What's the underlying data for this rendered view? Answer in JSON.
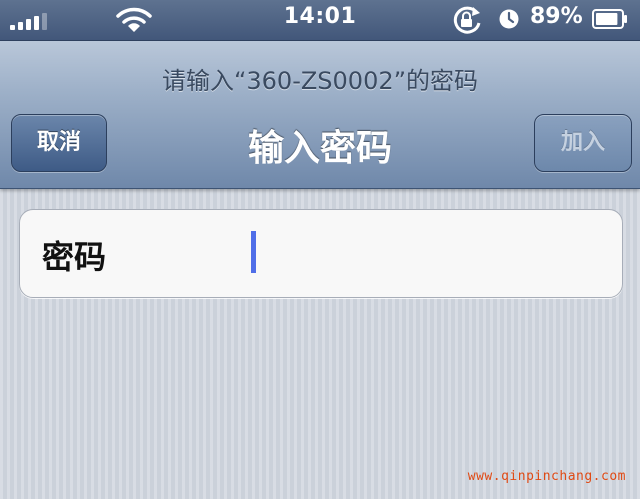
{
  "status_bar": {
    "time": "14:01",
    "battery_percent": "89%",
    "signal_bars_filled": 4,
    "signal_bars_total": 5,
    "battery_level": 0.89,
    "icons": [
      "signal-icon",
      "wifi-icon",
      "rotation-lock-icon",
      "alarm-icon",
      "battery-icon"
    ]
  },
  "nav": {
    "prompt": "请输入“360-ZS0002”的密码",
    "title": "输入密码",
    "cancel_label": "取消",
    "join_label": "加入"
  },
  "form": {
    "password_label": "密码",
    "password_value": ""
  },
  "watermark": "www.qinpinchang.com",
  "colors": {
    "status_bar": "#4b5f80",
    "nav_bar_top": "#b9c7d9",
    "nav_bar_bottom": "#6f88aa",
    "cursor": "#4f6ee8",
    "watermark": "#e04a14"
  }
}
